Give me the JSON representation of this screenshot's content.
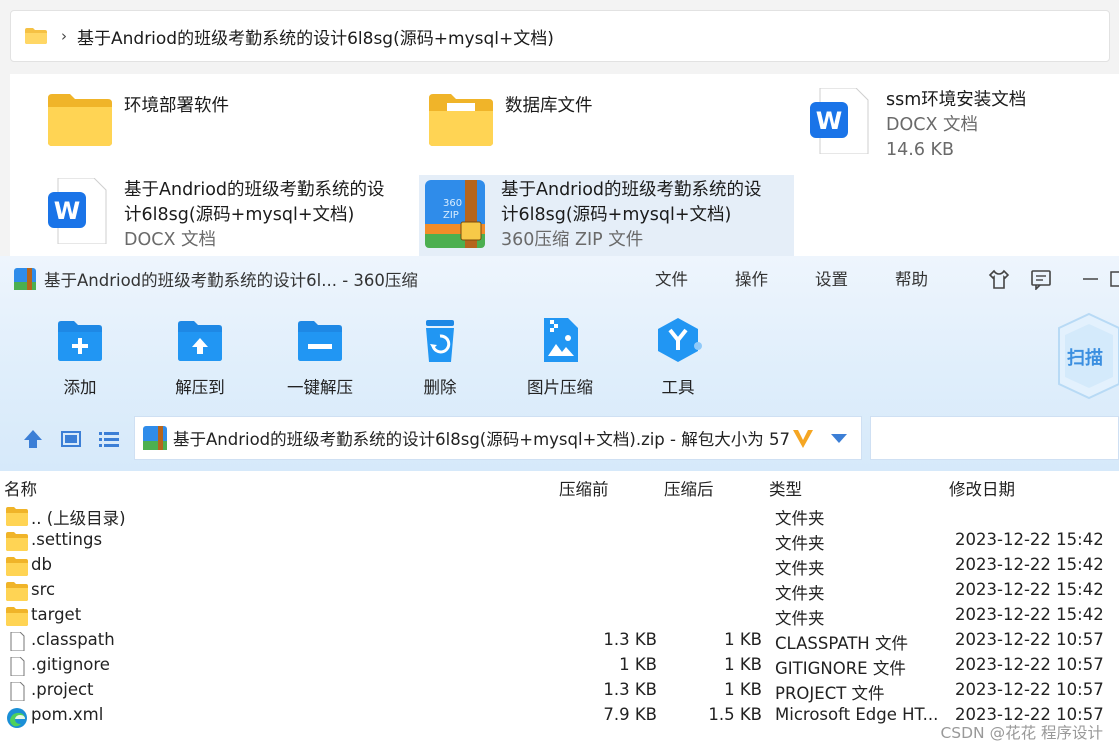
{
  "explorer": {
    "breadcrumb": "基于Andriod的班级考勤系统的设计6l8sg(源码+mysql+文档)",
    "items": [
      {
        "name": "环境部署软件",
        "sub": "",
        "sub2": ""
      },
      {
        "name": "数据库文件",
        "sub": "",
        "sub2": ""
      },
      {
        "name": "ssm环境安装文档",
        "sub": "DOCX 文档",
        "sub2": "14.6 KB"
      },
      {
        "name": "基于Andriod的班级考勤系统的设",
        "name2": "计6l8sg(源码+mysql+文档)",
        "sub": "DOCX 文档"
      },
      {
        "name": "基于Andriod的班级考勤系统的设",
        "name2": "计6l8sg(源码+mysql+文档)",
        "sub": "360压缩 ZIP 文件"
      }
    ]
  },
  "zip_window": {
    "title": "基于Andriod的班级考勤系统的设计6l... - 360压缩",
    "menu": [
      "文件",
      "操作",
      "设置",
      "帮助"
    ],
    "toolbar": [
      "添加",
      "解压到",
      "一键解压",
      "删除",
      "图片压缩",
      "工具"
    ],
    "scan_label": "扫描",
    "address": "基于Andriod的班级考勤系统的设计6l8sg(源码+mysql+文档).zip - 解包大小为 57",
    "columns": {
      "name": "名称",
      "compressed_before": "压缩前",
      "compressed_after": "压缩后",
      "type": "类型",
      "modified": "修改日期"
    },
    "rows": [
      {
        "name": ".. (上级目录)",
        "before": "",
        "after": "",
        "type": "文件夹",
        "date": "",
        "icon": "folder-icon"
      },
      {
        "name": ".settings",
        "before": "",
        "after": "",
        "type": "文件夹",
        "date": "2023-12-22 15:42",
        "icon": "folder-icon"
      },
      {
        "name": "db",
        "before": "",
        "after": "",
        "type": "文件夹",
        "date": "2023-12-22 15:42",
        "icon": "folder-icon"
      },
      {
        "name": "src",
        "before": "",
        "after": "",
        "type": "文件夹",
        "date": "2023-12-22 15:42",
        "icon": "folder-icon"
      },
      {
        "name": "target",
        "before": "",
        "after": "",
        "type": "文件夹",
        "date": "2023-12-22 15:42",
        "icon": "folder-icon"
      },
      {
        "name": ".classpath",
        "before": "1.3 KB",
        "after": "1 KB",
        "type": "CLASSPATH 文件",
        "date": "2023-12-22 10:57",
        "icon": "file-icon"
      },
      {
        "name": ".gitignore",
        "before": "1 KB",
        "after": "1 KB",
        "type": "GITIGNORE 文件",
        "date": "2023-12-22 10:57",
        "icon": "file-icon"
      },
      {
        "name": ".project",
        "before": "1.3 KB",
        "after": "1 KB",
        "type": "PROJECT 文件",
        "date": "2023-12-22 10:57",
        "icon": "file-icon"
      },
      {
        "name": "pom.xml",
        "before": "7.9 KB",
        "after": "1.5 KB",
        "type": "Microsoft Edge HT...",
        "date": "2023-12-22 10:57",
        "icon": "edge-icon"
      }
    ]
  },
  "watermark": "CSDN @花花 程序设计"
}
